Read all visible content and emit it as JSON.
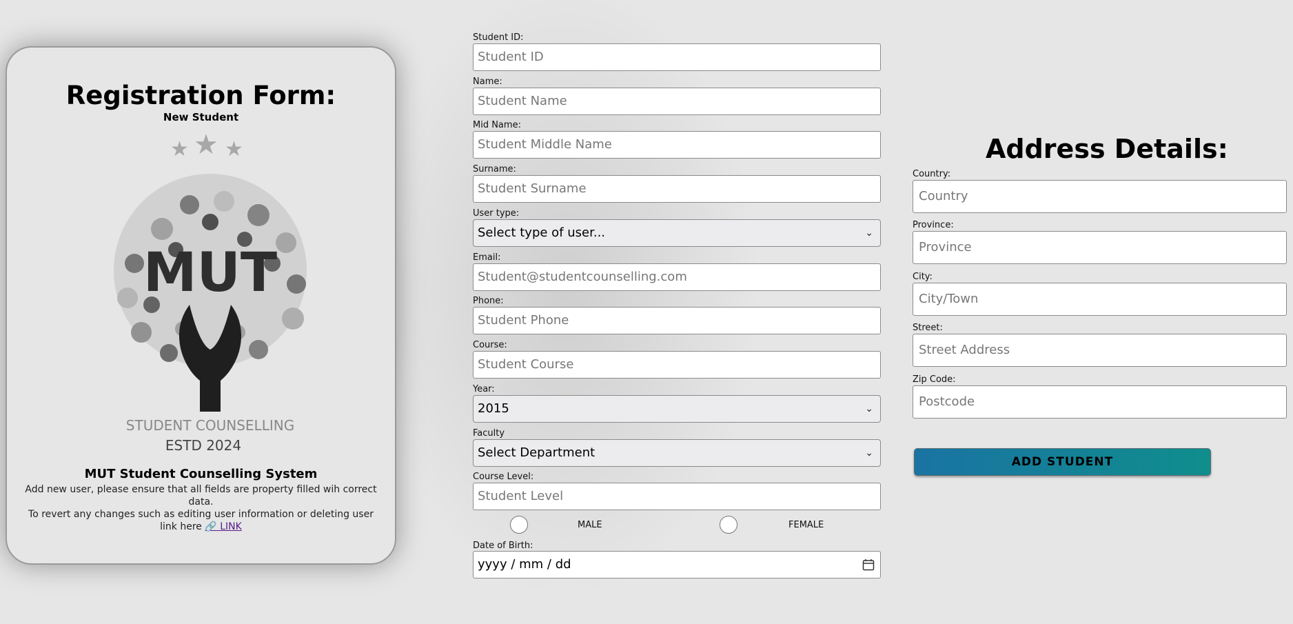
{
  "card": {
    "title": "Registration Form:",
    "subtitle": "New Student",
    "logo_text_main": "MUT",
    "logo_text_line1": "STUDENT COUNSELLING",
    "logo_text_line2": "ESTD 2024",
    "system_name": "MUT Student Counselling System",
    "description_1": "Add new user, please ensure that all fields are property filled wih correct data.",
    "description_2": "To revert any changes such as editing user information or deleting user link here",
    "link_icon": "link-icon",
    "link_label": "LINK"
  },
  "form": {
    "student_id": {
      "label": "Student ID:",
      "placeholder": "Student ID"
    },
    "name": {
      "label": "Name:",
      "placeholder": "Student Name"
    },
    "mid_name": {
      "label": "Mid Name:",
      "placeholder": "Student Middle Name"
    },
    "surname": {
      "label": "Surname:",
      "placeholder": "Student Surname"
    },
    "user_type": {
      "label": "User type:",
      "value": "Select type of user..."
    },
    "email": {
      "label": "Email:",
      "placeholder": "Student@studentcounselling.com"
    },
    "phone": {
      "label": "Phone:",
      "placeholder": "Student Phone"
    },
    "course": {
      "label": "Course:",
      "placeholder": "Student Course"
    },
    "year": {
      "label": "Year:",
      "value": "2015"
    },
    "faculty": {
      "label": "Faculty",
      "value": "Select Department"
    },
    "course_level": {
      "label": "Course Level:",
      "placeholder": "Student Level"
    },
    "gender": {
      "male_label": "MALE",
      "female_label": "FEMALE"
    },
    "dob": {
      "label": "Date of Birth:",
      "placeholder": "yyyy / mm / dd"
    }
  },
  "address": {
    "title": "Address Details:",
    "country": {
      "label": "Country:",
      "placeholder": "Country"
    },
    "province": {
      "label": "Province:",
      "placeholder": "Province"
    },
    "city": {
      "label": "City:",
      "placeholder": "City/Town"
    },
    "street": {
      "label": "Street:",
      "placeholder": "Street Address"
    },
    "zip": {
      "label": "Zip Code:",
      "placeholder": "Postcode"
    }
  },
  "actions": {
    "add_student_label": "ADD STUDENT"
  },
  "colors": {
    "button_start": "#1a73a3",
    "button_end": "#0f8e8c",
    "link": "#551a8b",
    "background": "#e6e6e6"
  }
}
